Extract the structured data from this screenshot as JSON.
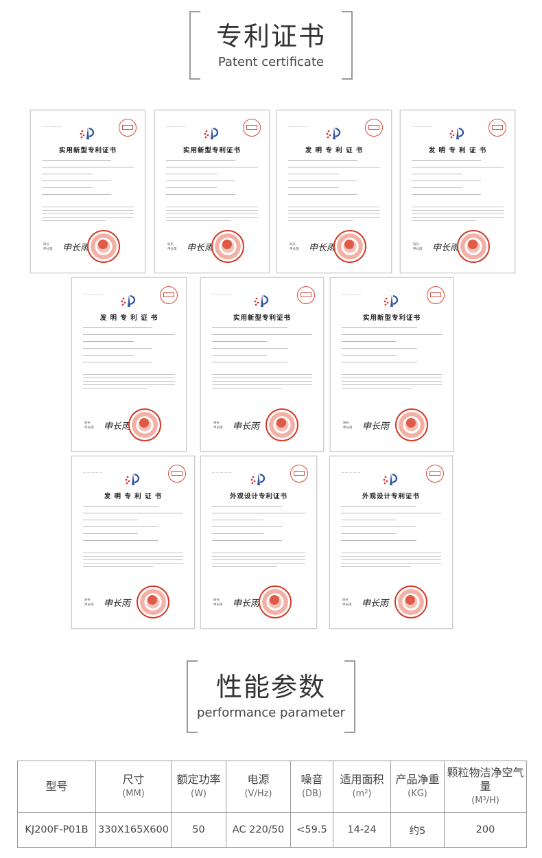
{
  "section1": {
    "title": "专利证书",
    "subtitle": "Patent certificate"
  },
  "certificates": [
    {
      "title": "实用新型专利证书"
    },
    {
      "title": "实用新型专利证书"
    },
    {
      "title": "发 明 专 利 证 书"
    },
    {
      "title": "发 明 专 利 证 书"
    },
    {
      "title": "发 明 专 利 证 书"
    },
    {
      "title": "实用新型专利证书"
    },
    {
      "title": "实用新型专利证书"
    },
    {
      "title": "发 明 专 利 证 书"
    },
    {
      "title": "外观设计专利证书"
    },
    {
      "title": "外观设计专利证书"
    }
  ],
  "section2": {
    "title": "性能参数",
    "subtitle": "performance parameter"
  },
  "spec_table": {
    "headers": [
      {
        "name": "型号",
        "unit": ""
      },
      {
        "name": "尺寸",
        "unit": "(MM)"
      },
      {
        "name": "额定功率",
        "unit": "(W)"
      },
      {
        "name": "电源",
        "unit": "(V/Hz)"
      },
      {
        "name": "噪音",
        "unit": "(DB)"
      },
      {
        "name": "适用面积",
        "unit": "(m²)"
      },
      {
        "name": "产品净重",
        "unit": "(KG)"
      },
      {
        "name": "颗粒物洁净空气量",
        "unit": "(M³/H)"
      }
    ],
    "row": [
      "KJ200F-P01B",
      "330X165X600",
      "50",
      "AC 220/50",
      "<59.5",
      "14-24",
      "约5",
      "200"
    ]
  }
}
